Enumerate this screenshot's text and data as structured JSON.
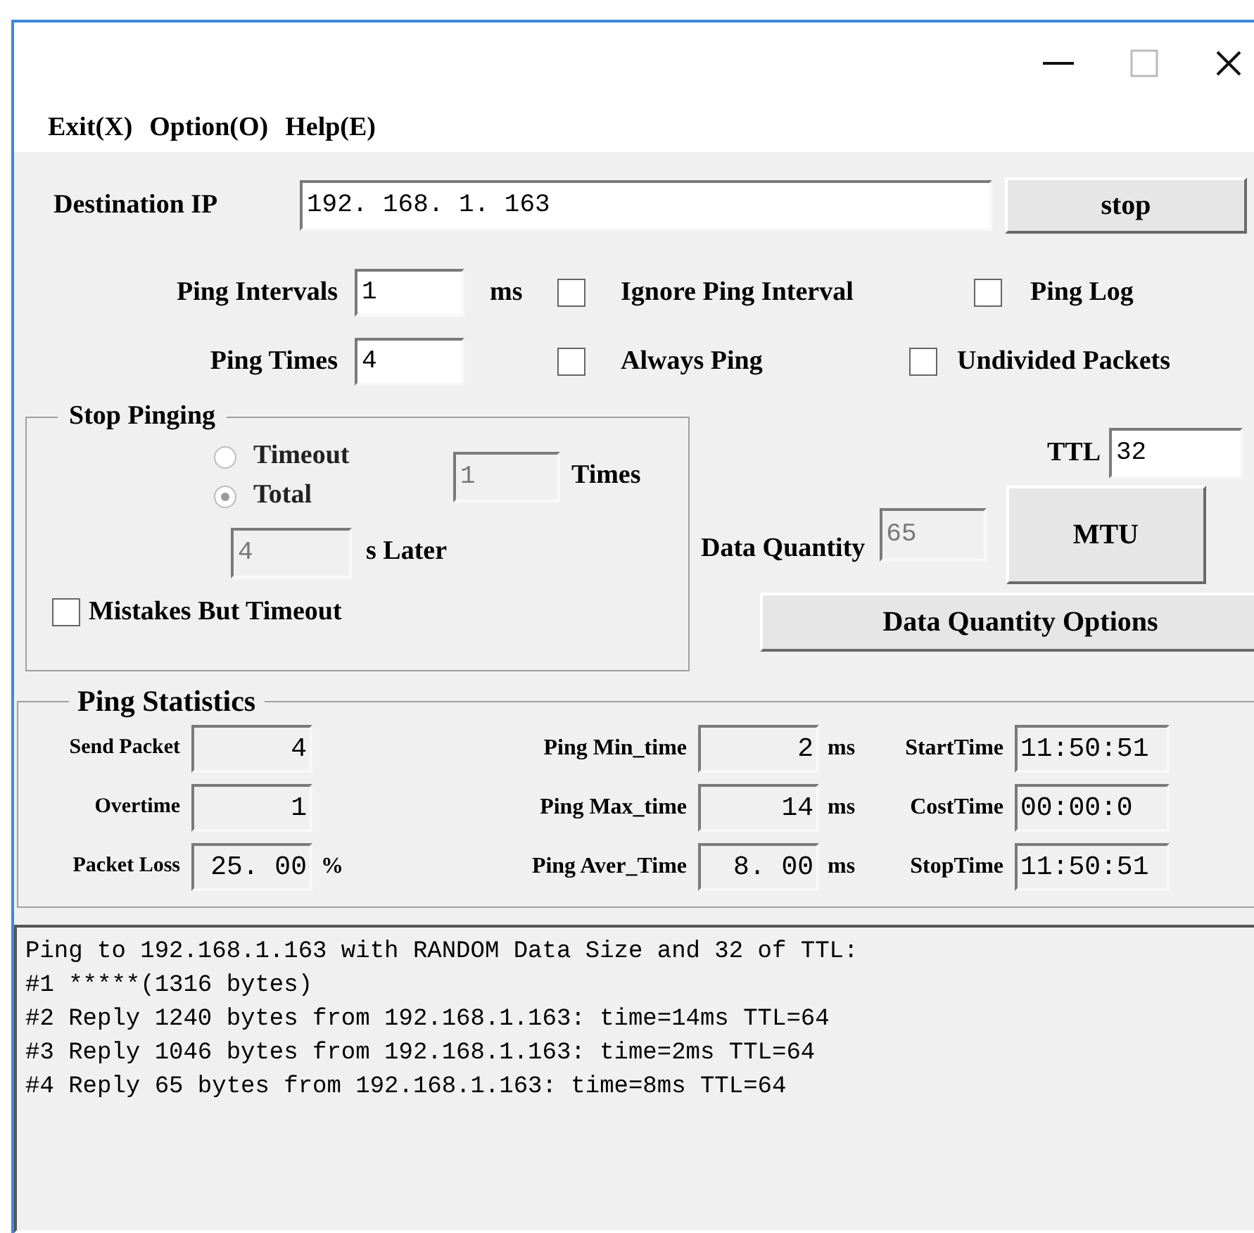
{
  "menu": [
    {
      "label": "Exit(X)"
    },
    {
      "label": "Option(O)"
    },
    {
      "label": "Help(E)"
    }
  ],
  "destination": {
    "label": "Destination IP",
    "value": "192. 168. 1. 163"
  },
  "stop_button": "stop",
  "ping_intervals": {
    "label": "Ping Intervals",
    "value": "1",
    "unit": "ms"
  },
  "ping_times": {
    "label": "Ping Times",
    "value": "4"
  },
  "options": [
    {
      "label": "Ignore Ping Interval",
      "checked": false
    },
    {
      "label": "Ping Log",
      "checked": false
    },
    {
      "label": "Always Ping",
      "checked": false
    },
    {
      "label": "Undivided Packets",
      "checked": false
    }
  ],
  "stop_pinging": {
    "title": "Stop  Pinging",
    "radios": [
      {
        "label": "Timeout",
        "selected": false,
        "disabled": true
      },
      {
        "label": "Total",
        "selected": true,
        "disabled": true
      }
    ],
    "times_field": {
      "value": "1",
      "disabled": true
    },
    "times_label": "Times",
    "later_field": {
      "value": "4",
      "disabled": true
    },
    "later_label": "s Later",
    "mistakes": {
      "label": "Mistakes But Timeout",
      "checked": false
    }
  },
  "ttl": {
    "label": "TTL",
    "value": "32"
  },
  "data_quantity": {
    "label": "Data Quantity",
    "value": "65",
    "disabled": true
  },
  "mtu_button": "MTU",
  "data_quantity_options_button": "Data Quantity Options",
  "statistics": {
    "title": "Ping Statistics",
    "fields": [
      {
        "label": "Send Packet",
        "value": "4"
      },
      {
        "label": "Ping Min_time",
        "value": "2",
        "unit": "ms"
      },
      {
        "label": "StartTime",
        "value": "11:50:51"
      },
      {
        "label": "Overtime",
        "value": "1"
      },
      {
        "label": "Ping Max_time",
        "value": "14",
        "unit": "ms"
      },
      {
        "label": "CostTime",
        "value": "00:00:0"
      },
      {
        "label": "Packet Loss",
        "value": "25. 00",
        "unit": "%"
      },
      {
        "label": "Ping Aver_Time",
        "value": "8. 00",
        "unit": "ms"
      },
      {
        "label": "StopTime",
        "value": "11:50:51"
      }
    ]
  },
  "log": [
    "Ping to 192.168.1.163 with RANDOM Data Size and 32 of TTL:",
    "#1 *****(1316 bytes)",
    "#2 Reply 1240 bytes from 192.168.1.163: time=14ms TTL=64",
    "#3 Reply 1046 bytes from 192.168.1.163: time=2ms TTL=64",
    "#4 Reply 65 bytes from 192.168.1.163: time=8ms TTL=64"
  ]
}
